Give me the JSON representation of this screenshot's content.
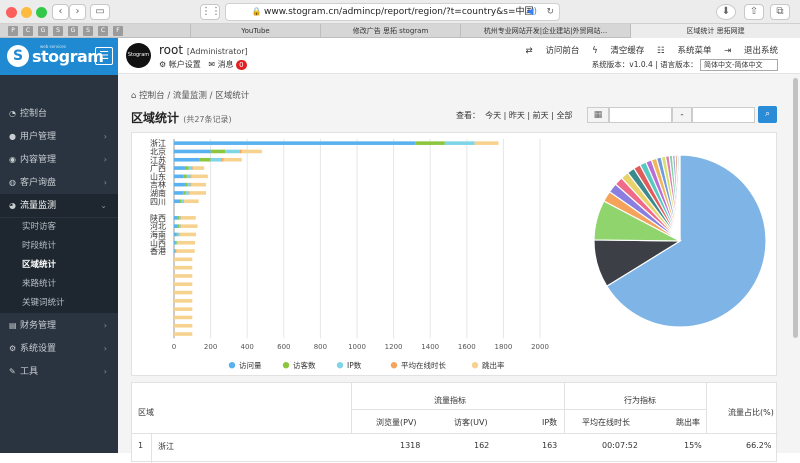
{
  "browser": {
    "url": "www.stogram.cn/admincp/report/region/?t=country&s=中国",
    "favicons": [
      "P",
      "C",
      "G",
      "S",
      "G",
      "S",
      "C",
      "F"
    ],
    "tabs": [
      "YouTube",
      "修改广告 思拓 stogram",
      "杭州专业网站开发|企业建站|外贸网站...",
      "区域统计 思拓网建"
    ]
  },
  "sidebar": {
    "logo": "stogram",
    "logo_sub": "web services",
    "items": [
      {
        "label": "控制台",
        "icon": "dashboard-icon"
      },
      {
        "label": "用户管理",
        "icon": "user-icon"
      },
      {
        "label": "内容管理",
        "icon": "content-icon"
      },
      {
        "label": "客户询盘",
        "icon": "inquiry-icon"
      },
      {
        "label": "流量监测",
        "icon": "traffic-icon"
      }
    ],
    "subitems": [
      "实时访客",
      "时段统计",
      "区域统计",
      "来路统计",
      "关键词统计"
    ],
    "items2": [
      {
        "label": "财务管理",
        "icon": "finance-icon"
      },
      {
        "label": "系统设置",
        "icon": "settings-icon"
      },
      {
        "label": "工具",
        "icon": "tools-icon"
      }
    ]
  },
  "topbar": {
    "avatar_text": "Stogram",
    "username": "root",
    "role": "[Administrator]",
    "account": "帐户设置",
    "messages": "消息",
    "msg_count": "0",
    "links": [
      "访问前台",
      "清空缓存",
      "系统菜单",
      "退出系统"
    ],
    "version": "系统版本：v1.0.4 | 语言版本：",
    "lang": "简体中文-简体中文"
  },
  "page": {
    "breadcrumb": [
      "控制台",
      "流量监测",
      "区域统计"
    ],
    "title": "区域统计",
    "count": "(共27条记录)",
    "view_label": "查看：",
    "views": [
      "今天",
      "昨天",
      "前天",
      "全部"
    ],
    "date_sep": "-"
  },
  "chart_data": [
    {
      "type": "bar",
      "stacked": true,
      "orientation": "horizontal",
      "categories": [
        "浙江",
        "北京",
        "江苏",
        "广西",
        "山东",
        "吉林",
        "湖南",
        "四川",
        "",
        "陕西",
        "河北",
        "海南",
        "山西",
        "香港"
      ],
      "category_tick_labels": [
        "浙江",
        "北京",
        "江苏",
        "广西",
        "山东",
        "吉林",
        "湖南",
        "四川",
        "",
        "陕西",
        "河北",
        "海南",
        "山西",
        "香港"
      ],
      "n_rows": 24,
      "category_row_index": [
        0,
        1,
        2,
        3,
        4,
        5,
        6,
        7,
        8,
        9,
        10,
        11,
        12,
        13
      ],
      "series": [
        {
          "name": "访问量",
          "color": "#5ab1ef",
          "values": [
            1318,
            200,
            140,
            60,
            50,
            60,
            50,
            30,
            0,
            20,
            20,
            15,
            10,
            5
          ]
        },
        {
          "name": "访客数",
          "color": "#8cc63e",
          "values": [
            162,
            80,
            60,
            20,
            20,
            15,
            15,
            10,
            0,
            8,
            8,
            6,
            4,
            3
          ]
        },
        {
          "name": "IP数",
          "color": "#7fd4e8",
          "values": [
            163,
            80,
            60,
            20,
            20,
            15,
            15,
            10,
            0,
            8,
            8,
            6,
            4,
            3
          ]
        },
        {
          "name": "平均在线时长",
          "color": "#f5a45c",
          "values": [
            0,
            10,
            10,
            5,
            5,
            5,
            5,
            5,
            0,
            3,
            3,
            3,
            2,
            2
          ]
        },
        {
          "name": "跳出率",
          "color": "#f6d28e",
          "values": [
            130,
            110,
            100,
            60,
            90,
            80,
            90,
            80,
            0,
            80,
            90,
            90,
            95,
            100
          ]
        }
      ],
      "xlim": [
        0,
        2000
      ],
      "xticks": [
        0,
        200,
        400,
        600,
        800,
        1000,
        1200,
        1400,
        1600,
        1800,
        2000
      ]
    },
    {
      "type": "pie",
      "values": [
        66.2,
        9.0,
        7.5,
        2.0,
        1.8,
        1.6,
        1.5,
        1.4,
        1.3,
        1.2,
        1.1,
        1.0,
        0.9,
        0.8,
        0.7,
        0.6,
        0.5,
        0.4,
        0.3,
        0.2
      ],
      "colors": [
        "#7eb4e6",
        "#3d3f47",
        "#8fd46d",
        "#f5a35a",
        "#8a7fe0",
        "#f06b8a",
        "#e8d26a",
        "#3d8a8e",
        "#e05b5b",
        "#59c8c2",
        "#b86fd6",
        "#f0b65a",
        "#6f9be0",
        "#d6e06b",
        "#e07bb3",
        "#7cd6a1",
        "#a9a9d6",
        "#e0956b",
        "#6bc0e0",
        "#c8e06b"
      ]
    }
  ],
  "table": {
    "headers": {
      "region": "区域",
      "traffic": "流量指标",
      "behavior": "行为指标",
      "share": "流量占比(%)",
      "pv": "浏览量(PV)",
      "uv": "访客(UV)",
      "ip": "IP数",
      "avg": "平均在线时长",
      "bounce": "跳出率"
    },
    "rows": [
      {
        "idx": "1",
        "region": "浙江",
        "pv": "1318",
        "uv": "162",
        "ip": "163",
        "avg": "00:07:52",
        "bounce": "15%",
        "share": "66.2%"
      }
    ]
  }
}
